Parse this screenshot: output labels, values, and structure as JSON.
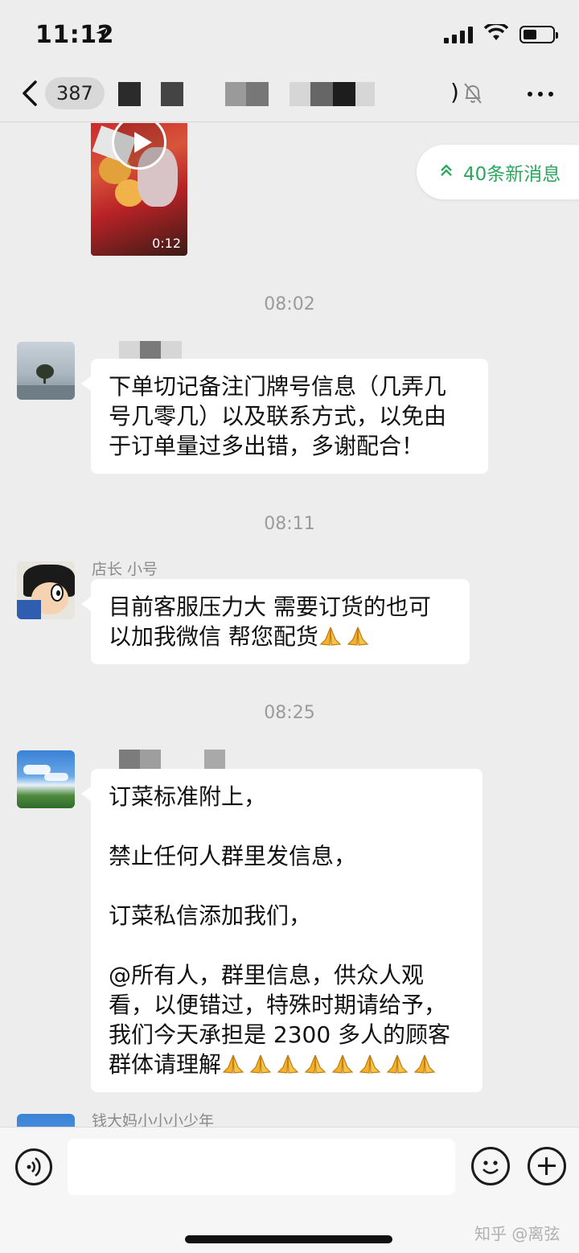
{
  "status_bar": {
    "time": "11:12",
    "battery_level": 0.5
  },
  "header": {
    "unread_count": "387",
    "paren": ")"
  },
  "new_messages": {
    "label": "40条新消息"
  },
  "video": {
    "duration": "0:12"
  },
  "messages": [
    {
      "time": "08:02",
      "sender": "我",
      "lines": [
        "下单切记备注门牌号信息（几弄几",
        "号几零几）以及联系方式，以免由",
        "于订单量过多出错，多谢配合！"
      ]
    },
    {
      "time": "08:11",
      "sender": "店长 小号",
      "lines": [
        "目前客服压力大 需要订货的也可",
        "以加我微信 帮您配货"
      ],
      "pray_count": 2
    },
    {
      "time": "08:25",
      "sender": "",
      "paragraphs": [
        "订菜标准附上，",
        "禁止任何人群里发信息，",
        "订菜私信添加我们，",
        "@所有人，群里信息，供众人观",
        "看，以便错过，特殊时期请给予，",
        "我们今天承担是 2300 多人的顾客",
        "群体请理解"
      ],
      "pray_count": 8
    },
    {
      "sender": "钱大妈小小小少年"
    }
  ],
  "watermark": "知乎 @离弦"
}
